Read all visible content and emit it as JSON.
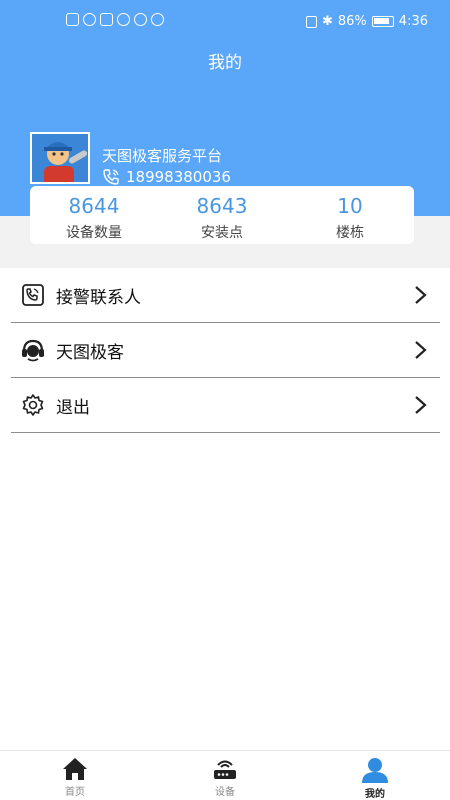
{
  "status_bar": {
    "battery": "86%",
    "time": "4:36"
  },
  "header": {
    "title": "我的"
  },
  "profile": {
    "name": "天图极客服务平台",
    "phone": "18998380036"
  },
  "stats": [
    {
      "value": "8644",
      "label": "设备数量"
    },
    {
      "value": "8643",
      "label": "安装点"
    },
    {
      "value": "10",
      "label": "楼栋"
    }
  ],
  "menu": [
    {
      "label": "接警联系人",
      "icon": "phone-contact-icon"
    },
    {
      "label": "天图极客",
      "icon": "headset-icon"
    },
    {
      "label": "退出",
      "icon": "gear-icon"
    }
  ],
  "tabbar": [
    {
      "label": "首页",
      "icon": "home-icon"
    },
    {
      "label": "设备",
      "icon": "router-icon"
    },
    {
      "label": "我的",
      "icon": "person-icon",
      "active": true
    }
  ],
  "colors": {
    "header": "#5aa6f8",
    "stat_value": "#4a96e0",
    "active_tab_icon": "#2f8ce0"
  }
}
